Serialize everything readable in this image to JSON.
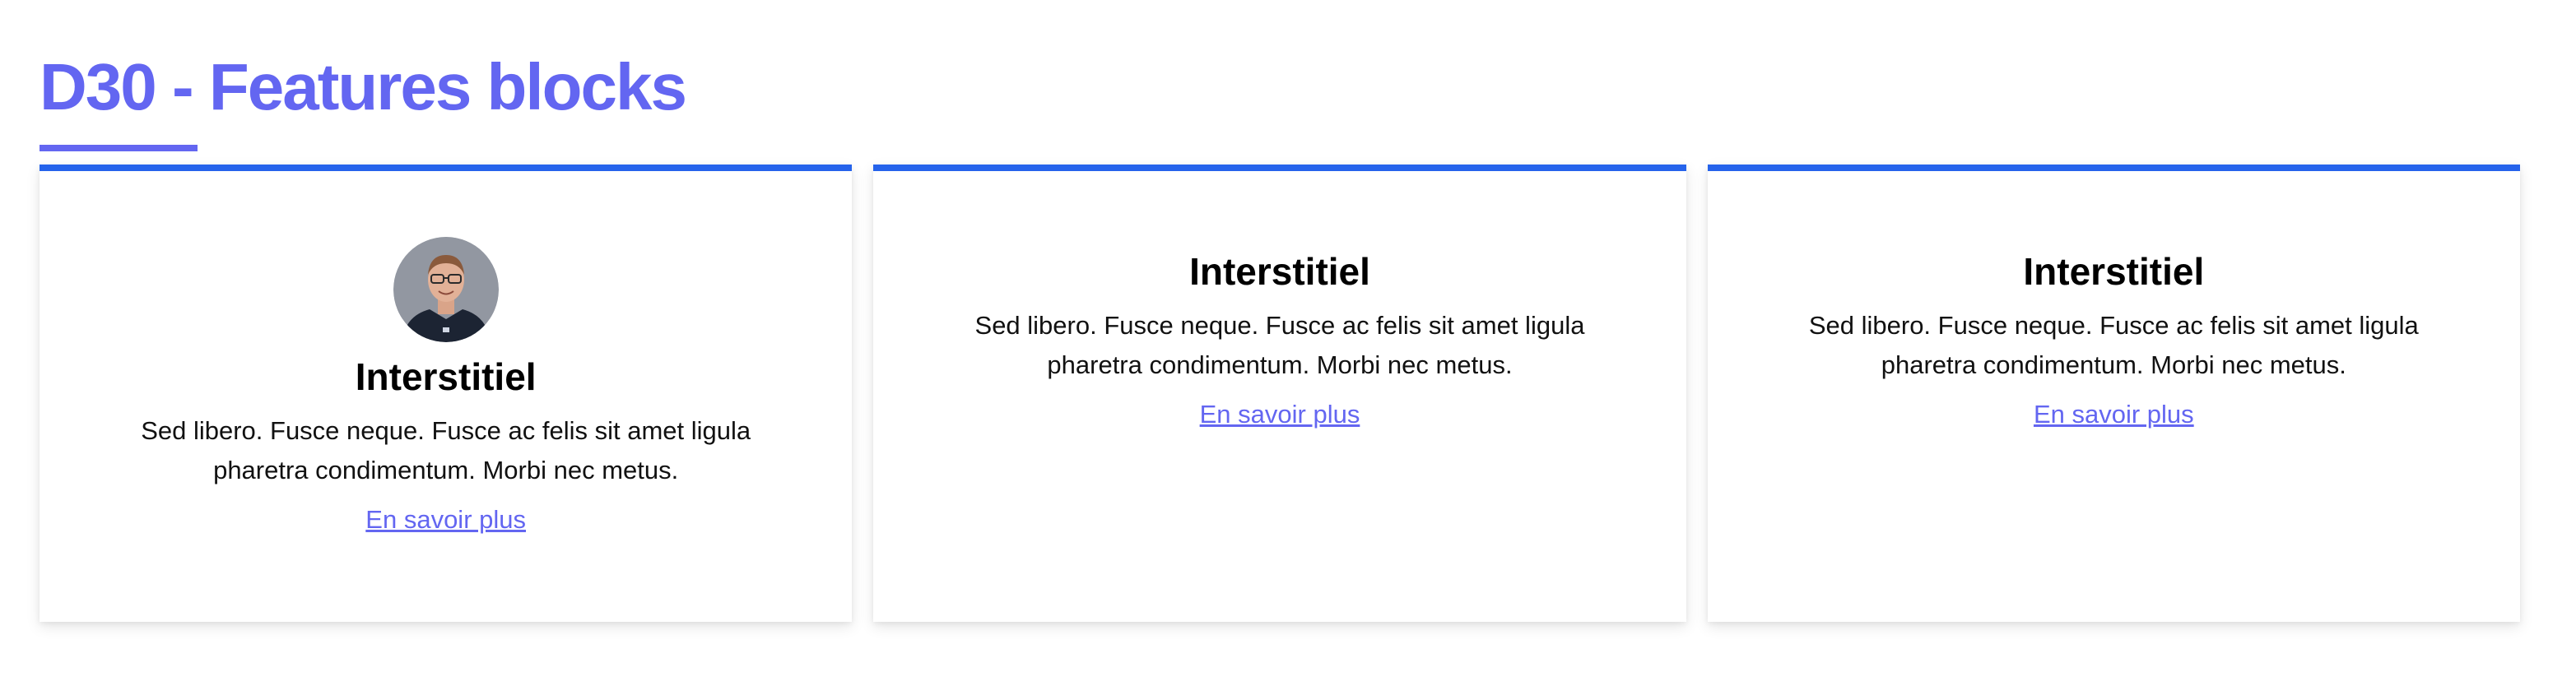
{
  "page": {
    "title": "D30 - Features blocks"
  },
  "colors": {
    "accent": "#6366f1",
    "card_border": "#2563eb",
    "background": "#ffffff"
  },
  "cards": [
    {
      "has_avatar": true,
      "avatar_icon": "person-avatar",
      "title": "Interstitiel",
      "text": "Sed libero. Fusce neque. Fusce ac felis sit amet ligula pharetra condimentum. Morbi nec metus.",
      "link": "En savoir plus"
    },
    {
      "has_avatar": false,
      "title": "Interstitiel",
      "text": "Sed libero. Fusce neque. Fusce ac felis sit amet ligula pharetra condimentum. Morbi nec metus.",
      "link": "En savoir plus"
    },
    {
      "has_avatar": false,
      "title": "Interstitiel",
      "text": "Sed libero. Fusce neque. Fusce ac felis sit amet ligula pharetra condimentum. Morbi nec metus.",
      "link": "En savoir plus"
    }
  ]
}
